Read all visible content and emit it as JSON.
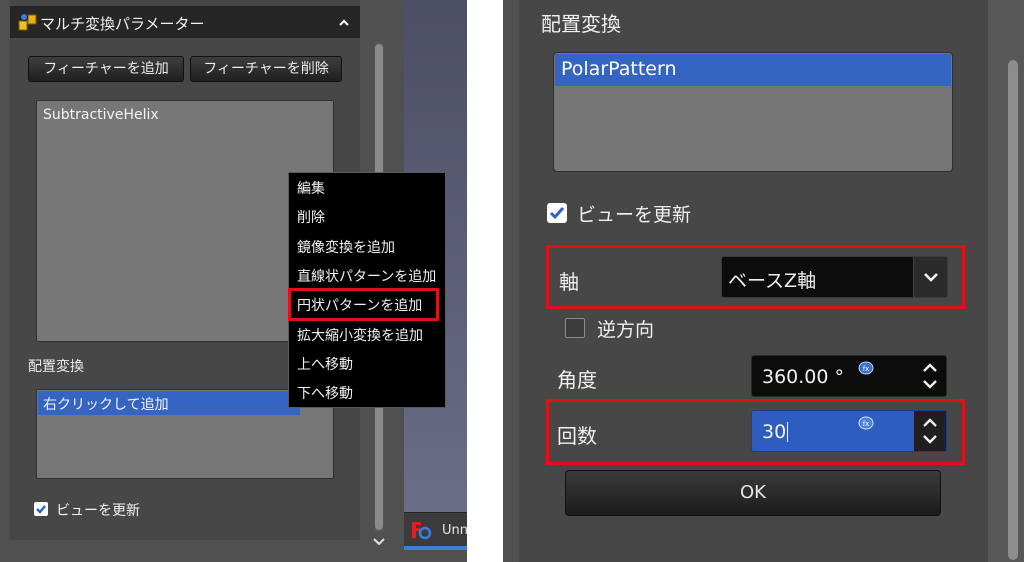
{
  "left": {
    "panel_title": "マルチ変換パラメーター",
    "add_feature_button": "フィーチャーを追加",
    "remove_feature_button": "フィーチャーを削除",
    "feature_list": [
      "SubtractiveHelix"
    ],
    "transform_section_label": "配置変換",
    "transform_list_placeholder": "右クリックして追加",
    "update_view_label": "ビューを更新",
    "update_view_checked": true,
    "taskbar_label": "Unn",
    "context_menu": {
      "items": [
        "編集",
        "削除",
        "鏡像変換を追加",
        "直線状パターンを追加",
        "円状パターンを追加",
        "拡大縮小変換を追加",
        "上へ移動",
        "下へ移動"
      ],
      "highlighted_index": 4
    }
  },
  "right": {
    "section_label": "配置変換",
    "transform_list": [
      "PolarPattern"
    ],
    "update_view_label": "ビューを更新",
    "update_view_checked": true,
    "axis_label": "軸",
    "axis_value": "ベースZ軸",
    "reverse_label": "逆方向",
    "reverse_checked": false,
    "angle_label": "角度",
    "angle_value": "360.00 °",
    "occurrences_label": "回数",
    "occurrences_value": "30",
    "ok_button": "OK"
  },
  "colors": {
    "panel_bg": "#474747",
    "selection_blue": "#3465c2",
    "highlight_red": "#e0101a",
    "spin_active": "#2e5dbf"
  },
  "icons": {
    "panel_logo": "multitransform-icon",
    "collapse": "chevron-up-icon",
    "dropdown": "chevron-down-icon",
    "spinner": "spinner-arrows-icon",
    "expression": "fx-expression-icon",
    "app": "freecad-icon"
  }
}
